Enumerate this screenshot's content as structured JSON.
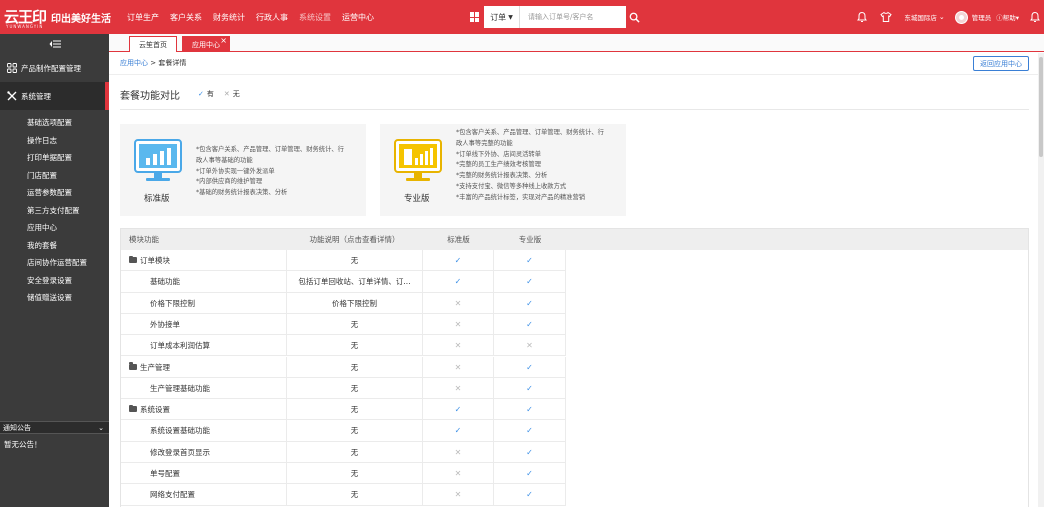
{
  "brand": {
    "logo_text": "云王印",
    "logo_sub": "YUNWANGYIN",
    "slogan": "印出美好生活",
    "accent": "#e0353d"
  },
  "nav": {
    "items": [
      {
        "label": "订单生产"
      },
      {
        "label": "客户关系"
      },
      {
        "label": "财务统计"
      },
      {
        "label": "行政人事"
      },
      {
        "label": "系统设置"
      },
      {
        "label": "运营中心"
      }
    ]
  },
  "search": {
    "type": "订单",
    "placeholder": "请输入订单号/客户名"
  },
  "user": {
    "store": "东城国际店",
    "name": "管理员",
    "help": "帮助"
  },
  "sidebar": {
    "groups": [
      {
        "label": "产品制作配置管理",
        "icon": "grid-icon"
      },
      {
        "label": "系统管理",
        "icon": "tools-icon"
      }
    ],
    "items": [
      {
        "label": "基础选项配置"
      },
      {
        "label": "操作日志"
      },
      {
        "label": "打印单据配置"
      },
      {
        "label": "门店配置"
      },
      {
        "label": "运营参数配置"
      },
      {
        "label": "第三方支付配置"
      },
      {
        "label": "应用中心"
      },
      {
        "label": "我的套餐"
      },
      {
        "label": "店间协作运营配置"
      },
      {
        "label": "安全登录设置"
      },
      {
        "label": "储值赠送设置"
      }
    ],
    "notice_title": "通知公告",
    "notice_text": "暂无公告！"
  },
  "tabs": [
    {
      "label": "云笙首页"
    },
    {
      "label": "应用中心"
    }
  ],
  "breadcrumb": {
    "parent": "应用中心",
    "sep": ">",
    "current": "套餐详情"
  },
  "back_button": "返回应用中心",
  "compare": {
    "title": "套餐功能对比",
    "legend_yes": "有",
    "legend_no": "无"
  },
  "versions": {
    "standard": {
      "name": "标准版",
      "desc": [
        "*包含客户关系、产品管理、订单管理、财务统计、行",
        "政人事等基础的功能",
        "*订单外协实现一键外发派单",
        "*内部供应商的维护管理",
        "*基础的财务统计报表决策、分析"
      ]
    },
    "pro": {
      "name": "专业版",
      "desc": [
        "*包含客户关系、产品管理、订单管理、财务统计、行",
        "政人事等完整的功能",
        "*订单线下外协、店间灵活转单",
        "*完整的员工生产绩效考核管理",
        "*完整的财务统计报表决策、分析",
        "*支持支付宝、微信等多种线上收款方式",
        "*丰富的产品统计标签，实现对产品的精准营销"
      ]
    }
  },
  "table": {
    "headers": {
      "module": "模块功能",
      "desc": "功能说明（点击查看详情）",
      "std": "标准版",
      "pro": "专业版"
    },
    "rows": [
      {
        "module": "订单模块",
        "group": true,
        "desc": "无",
        "std": "yes",
        "pro": "yes"
      },
      {
        "module": "基础功能",
        "group": false,
        "desc": "包括订单回收站、订单详情、订...",
        "std": "yes",
        "pro": "yes"
      },
      {
        "module": "价格下限控制",
        "group": false,
        "desc": "价格下限控制",
        "std": "no",
        "pro": "yes"
      },
      {
        "module": "外协接单",
        "group": false,
        "desc": "无",
        "std": "no",
        "pro": "yes"
      },
      {
        "module": "订单成本利润估算",
        "group": false,
        "desc": "无",
        "std": "no",
        "pro": "no"
      },
      {
        "module": "生产管理",
        "group": true,
        "desc": "无",
        "std": "no",
        "pro": "yes"
      },
      {
        "module": "生产管理基础功能",
        "group": false,
        "desc": "无",
        "std": "no",
        "pro": "yes"
      },
      {
        "module": "系统设置",
        "group": true,
        "desc": "无",
        "std": "yes",
        "pro": "yes"
      },
      {
        "module": "系统设置基础功能",
        "group": false,
        "desc": "无",
        "std": "yes",
        "pro": "yes"
      },
      {
        "module": "修改登录首页显示",
        "group": false,
        "desc": "无",
        "std": "no",
        "pro": "yes"
      },
      {
        "module": "单号配置",
        "group": false,
        "desc": "无",
        "std": "no",
        "pro": "yes"
      },
      {
        "module": "网络支付配置",
        "group": false,
        "desc": "无",
        "std": "no",
        "pro": "yes"
      }
    ],
    "yes_color": "#3a8ee6",
    "no_color": "#bbbbbb"
  }
}
